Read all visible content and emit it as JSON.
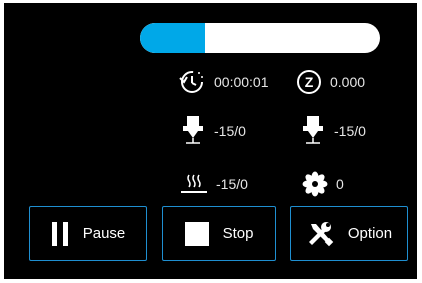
{
  "progress": {
    "percent": 27,
    "fill_color": "#00a8e8",
    "track_color": "#ffffff"
  },
  "stats": {
    "elapsed_time": "00:00:01",
    "z_height": "0.000",
    "nozzle1_temp": "-15/0",
    "nozzle2_temp": "-15/0",
    "bed_temp": "-15/0",
    "fan_speed": "0"
  },
  "z_icon_letter": "Z",
  "buttons": {
    "pause_label": "Pause",
    "stop_label": "Stop",
    "option_label": "Option"
  },
  "icons": {
    "elapsed_time": "clock-history-icon",
    "z_height": "z-axis-icon",
    "nozzle1": "extruder-nozzle-icon",
    "nozzle2": "extruder-nozzle-icon",
    "bed": "heated-bed-icon",
    "fan": "fan-icon",
    "pause": "pause-icon",
    "stop": "stop-icon",
    "option": "wrench-screwdriver-icon"
  },
  "colors": {
    "accent": "#1f8fd1",
    "background": "#000000",
    "text": "#e6e6e6"
  }
}
